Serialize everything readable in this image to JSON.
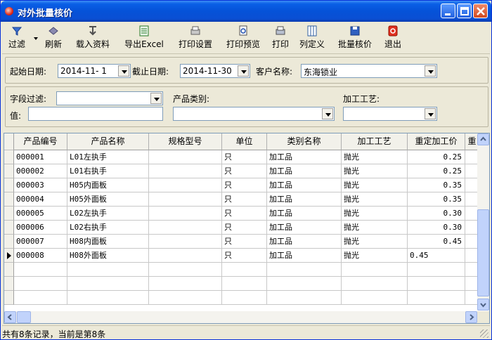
{
  "window": {
    "title": "对外批量核价",
    "accent": "#0a5fe6"
  },
  "toolbar": {
    "items": [
      {
        "label": "过滤",
        "icon": "filter-icon"
      },
      {
        "label": "刷新",
        "icon": "refresh-icon"
      },
      {
        "label": "载入资料",
        "icon": "load-data-icon"
      },
      {
        "label": "导出Excel",
        "icon": "excel-icon"
      },
      {
        "label": "打印设置",
        "icon": "print-settings-icon"
      },
      {
        "label": "打印预览",
        "icon": "print-preview-icon"
      },
      {
        "label": "打印",
        "icon": "printer-icon"
      },
      {
        "label": "列定义",
        "icon": "columns-icon"
      },
      {
        "label": "批量核价",
        "icon": "save-icon"
      },
      {
        "label": "退出",
        "icon": "exit-icon"
      }
    ]
  },
  "filters": {
    "start_date_label": "起始日期:",
    "start_date_value": "2014-11- 1",
    "end_date_label": "截止日期:",
    "end_date_value": "2014-11-30",
    "customer_label": "客户名称:",
    "customer_value": "东海锁业",
    "field_filter_label": "字段过滤:",
    "value_label": "值:",
    "category_label": "产品类别:",
    "process_label": "加工工艺:"
  },
  "grid": {
    "columns": [
      "产品编号",
      "产品名称",
      "规格型号",
      "单位",
      "类别名称",
      "加工工艺",
      "重定加工价",
      "重"
    ],
    "rows": [
      {
        "code": "000001",
        "name": "L01左执手",
        "spec": "",
        "unit": "只",
        "category": "加工品",
        "process": "抛光",
        "price": "0.25"
      },
      {
        "code": "000002",
        "name": "L01右执手",
        "spec": "",
        "unit": "只",
        "category": "加工品",
        "process": "抛光",
        "price": "0.25"
      },
      {
        "code": "000003",
        "name": "H05内面板",
        "spec": "",
        "unit": "只",
        "category": "加工品",
        "process": "抛光",
        "price": "0.35"
      },
      {
        "code": "000004",
        "name": "H05外面板",
        "spec": "",
        "unit": "只",
        "category": "加工品",
        "process": "抛光",
        "price": "0.35"
      },
      {
        "code": "000005",
        "name": "L02左执手",
        "spec": "",
        "unit": "只",
        "category": "加工品",
        "process": "抛光",
        "price": "0.30"
      },
      {
        "code": "000006",
        "name": "L02右执手",
        "spec": "",
        "unit": "只",
        "category": "加工品",
        "process": "抛光",
        "price": "0.30"
      },
      {
        "code": "000007",
        "name": "H08内面板",
        "spec": "",
        "unit": "只",
        "category": "加工品",
        "process": "抛光",
        "price": "0.45"
      },
      {
        "code": "000008",
        "name": "H08外面板",
        "spec": "",
        "unit": "只",
        "category": "加工品",
        "process": "抛光",
        "price": "0.45"
      }
    ],
    "current_row": 8
  },
  "status": {
    "text": "共有8条记录，当前是第8条"
  }
}
